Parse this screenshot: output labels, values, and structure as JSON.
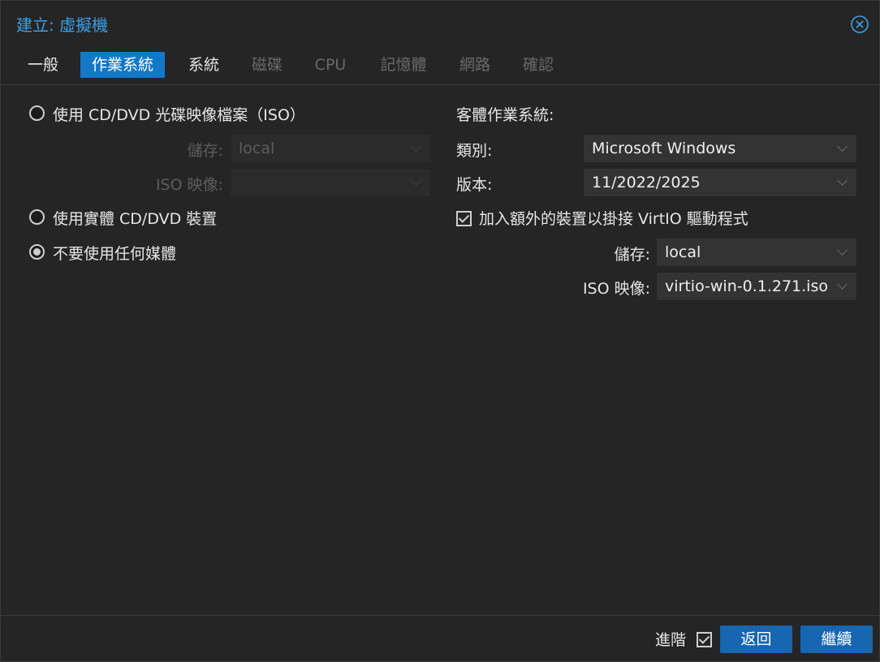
{
  "window": {
    "title": "建立: 虛擬機"
  },
  "tabs": [
    {
      "label": "一般",
      "state": "normal"
    },
    {
      "label": "作業系統",
      "state": "active"
    },
    {
      "label": "系統",
      "state": "normal"
    },
    {
      "label": "磁碟",
      "state": "disabled"
    },
    {
      "label": "CPU",
      "state": "disabled"
    },
    {
      "label": "記憶體",
      "state": "disabled"
    },
    {
      "label": "網路",
      "state": "disabled"
    },
    {
      "label": "確認",
      "state": "disabled"
    }
  ],
  "media": {
    "option_iso": "使用 CD/DVD 光碟映像檔案（ISO）",
    "option_iso_selected": false,
    "storage_label": "儲存:",
    "storage_value": "local",
    "iso_label": "ISO 映像:",
    "iso_value": "",
    "option_physical": "使用實體 CD/DVD 裝置",
    "option_physical_selected": false,
    "option_none": "不要使用任何媒體",
    "option_none_selected": true
  },
  "guest_os": {
    "heading": "客體作業系統:",
    "type_label": "類別:",
    "type_value": "Microsoft Windows",
    "version_label": "版本:",
    "version_value": "11/2022/2025",
    "virtio_checkbox_label": "加入額外的裝置以掛接 VirtIO 驅動程式",
    "virtio_checked": true,
    "storage_label": "儲存:",
    "storage_value": "local",
    "iso_label": "ISO 映像:",
    "iso_value": "virtio-win-0.1.271.iso"
  },
  "footer": {
    "advanced_label": "進階",
    "advanced_checked": true,
    "back_label": "返回",
    "next_label": "繼續"
  },
  "colors": {
    "accent": "#1478c8",
    "title": "#3aa0e6",
    "button": "#1666b0"
  }
}
